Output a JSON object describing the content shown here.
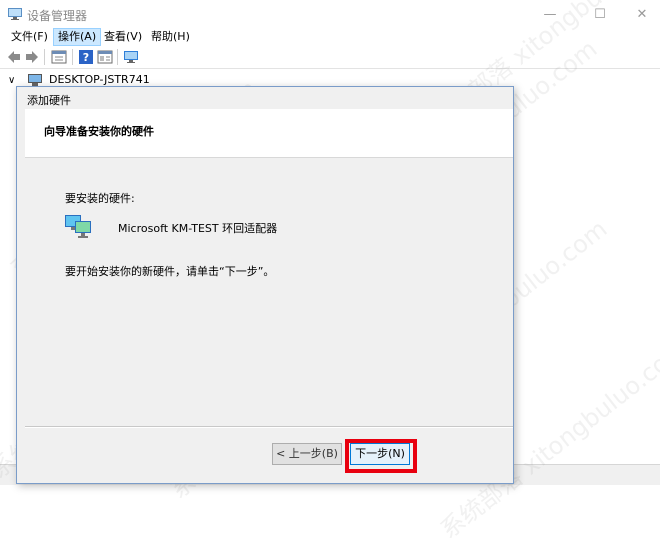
{
  "window": {
    "title": "设备管理器",
    "minimize": "—",
    "maximize": "☐",
    "close": "✕"
  },
  "menu": [
    "文件(F)",
    "操作(A)",
    "查看(V)",
    "帮助(H)"
  ],
  "tree": {
    "expander": "∨",
    "root": "DESKTOP-JSTR741"
  },
  "dialog": {
    "title": "添加硬件",
    "heading": "向导准备安装你的硬件",
    "hardware_label": "要安装的硬件:",
    "hardware_name": "Microsoft KM-TEST 环回适配器",
    "instruction": "要开始安装你的新硬件，请单击“下一步”。",
    "back_button": "< 上一步(B)",
    "next_button": "下一步(N)"
  },
  "watermark": "系统部落 xitongbuluo.com",
  "colors": {
    "highlight": "#e8000f",
    "accent": "#0078d7"
  }
}
